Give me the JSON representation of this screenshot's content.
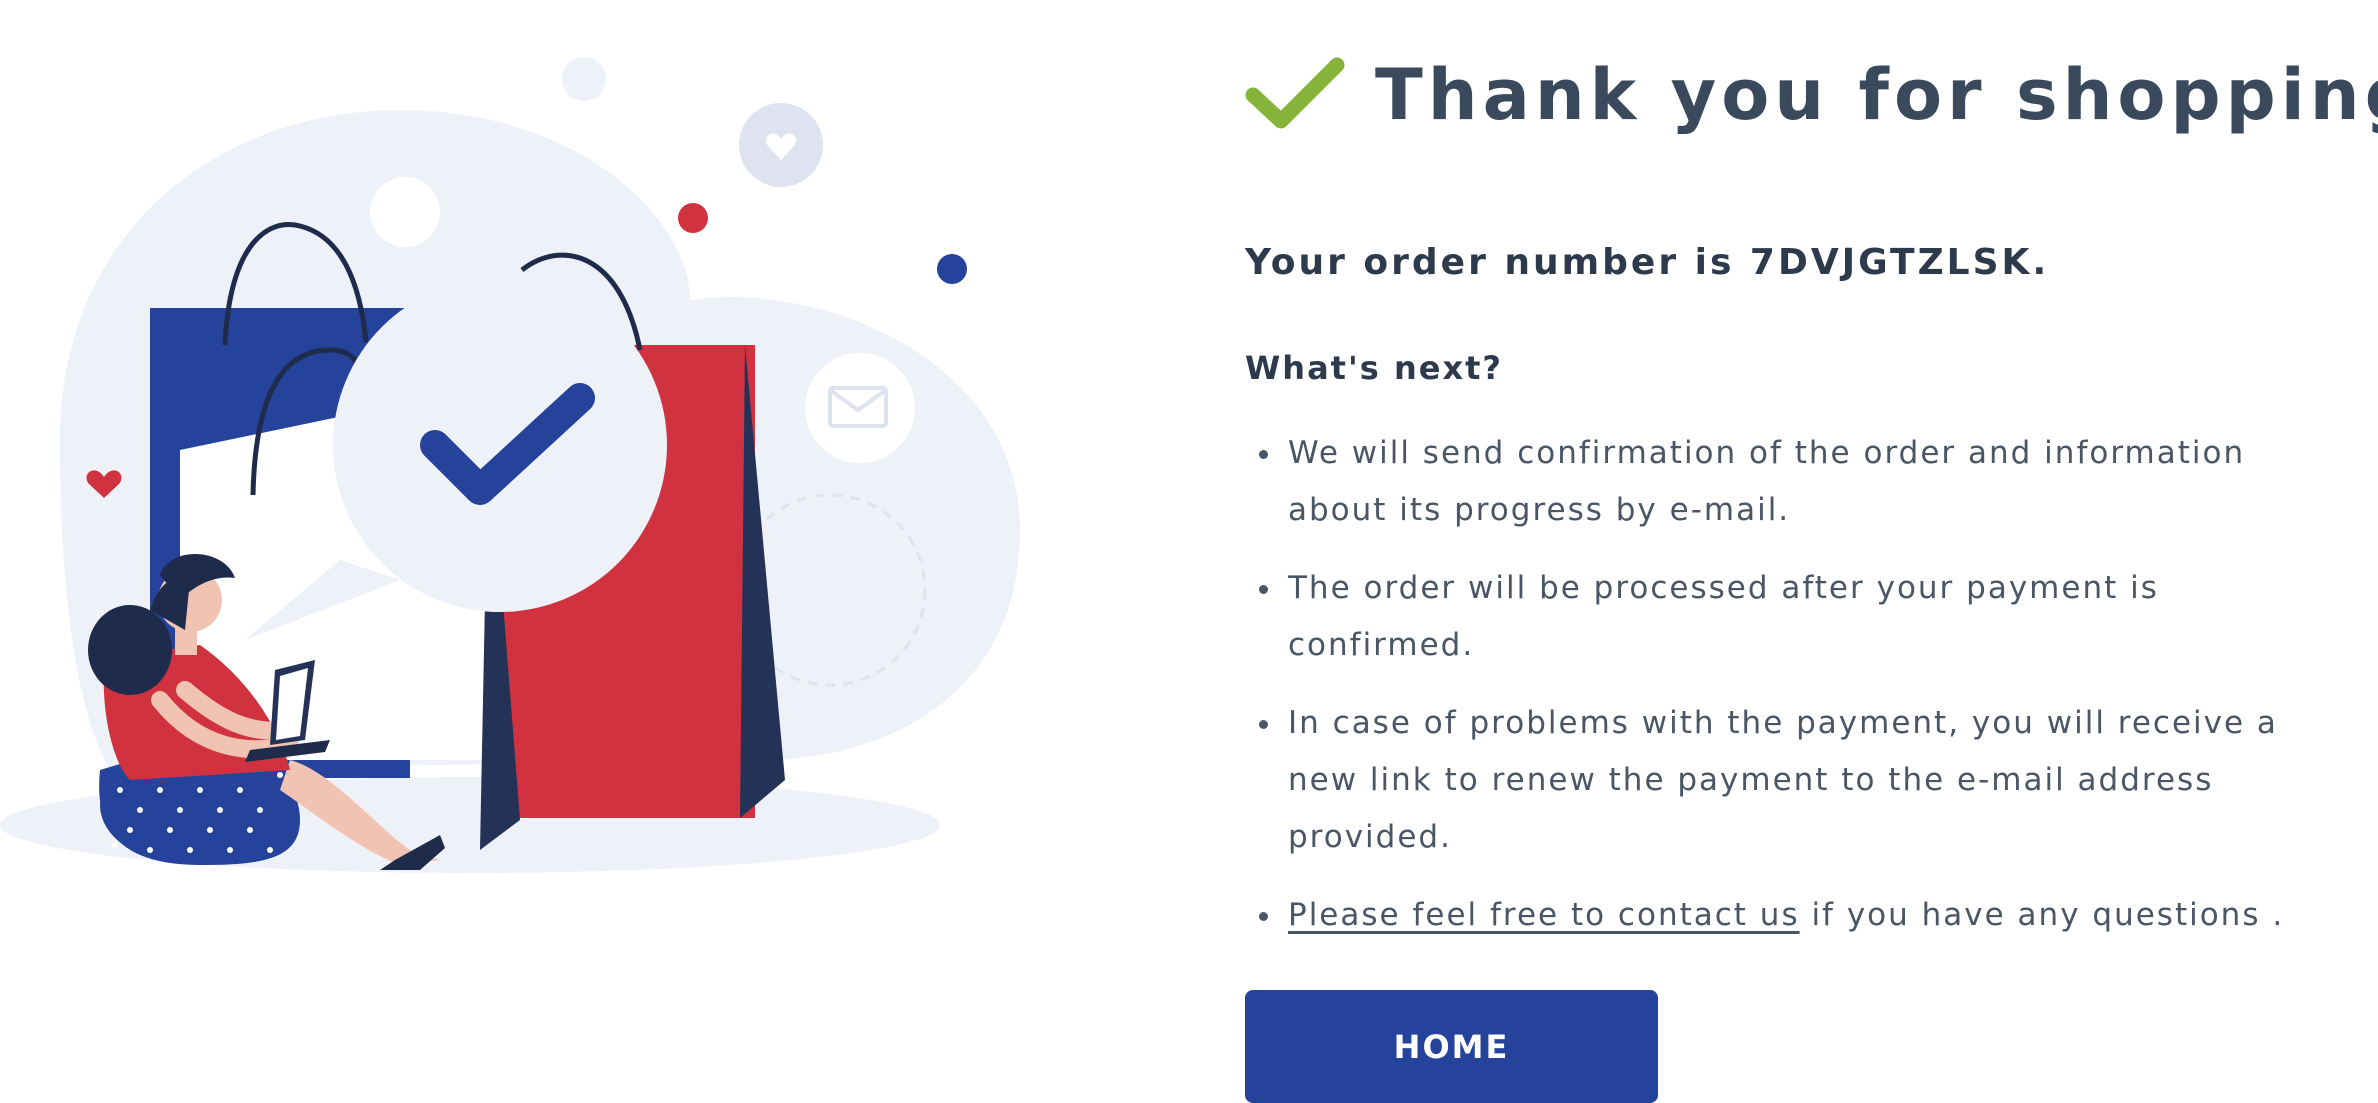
{
  "confirmation": {
    "title": "Thank you for shopping!",
    "order_prefix": "Your order number is ",
    "order_number": "7DVJGTZLSK",
    "order_suffix": ".",
    "whats_next": "What's next?",
    "steps": [
      "We will send confirmation of the order and information about its progress by e-mail.",
      "The order will be processed after your payment is confirmed.",
      "In case of problems with the payment, you will receive a new link to renew the payment to the e-mail address provided."
    ],
    "contact": {
      "link_text": "Please feel free to contact us",
      "after_text": " if you have any questions ."
    },
    "home_button": "HOME"
  },
  "icons": {
    "title_check": "check-icon",
    "illustration": "shopping-confirmation-illustration"
  },
  "colors": {
    "primary": "#25439a",
    "accent_red": "#d0323f",
    "check_green": "#86b43a",
    "text_dark": "#2d3a4c",
    "text_body": "#4a5566",
    "illustration_bg": "#eef1f8"
  }
}
